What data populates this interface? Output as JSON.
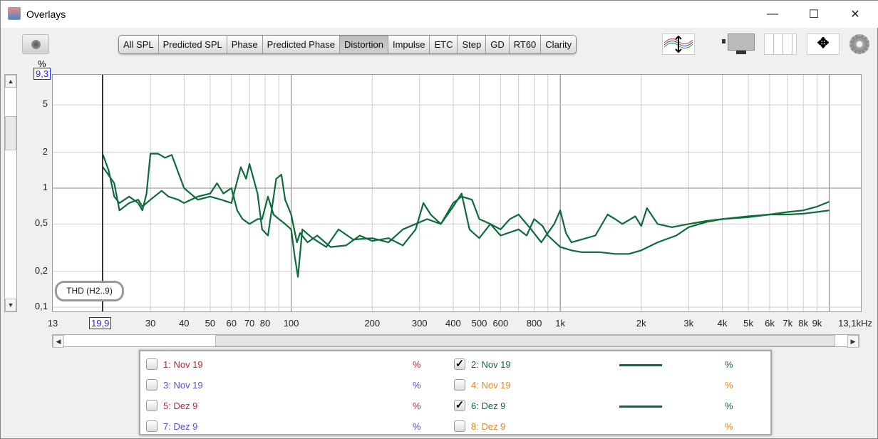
{
  "window": {
    "title": "Overlays",
    "minimize": "—",
    "maximize": "☐",
    "close": "✕"
  },
  "tabs": [
    {
      "label": "All SPL"
    },
    {
      "label": "Predicted SPL"
    },
    {
      "label": "Phase"
    },
    {
      "label": "Predicted Phase"
    },
    {
      "label": "Distortion",
      "active": true
    },
    {
      "label": "Impulse"
    },
    {
      "label": "ETC"
    },
    {
      "label": "Step"
    },
    {
      "label": "GD"
    },
    {
      "label": "RT60"
    },
    {
      "label": "Clarity"
    }
  ],
  "plot": {
    "y_unit": "%",
    "y_top_readout": "9,3",
    "x_cursor_readout": "19,9",
    "overlay_label": "THD (H2..9)"
  },
  "legend": [
    {
      "label": "1: Nov 19",
      "unit": "%",
      "checked": false,
      "color": "#c0282c"
    },
    {
      "label": "2: Nov 19",
      "unit": "%",
      "checked": true,
      "color": "#0e6b3a"
    },
    {
      "label": "3: Nov 19",
      "unit": "%",
      "checked": false,
      "color": "#5050d8"
    },
    {
      "label": "4: Nov 19",
      "unit": "%",
      "checked": false,
      "color": "#e08a20"
    },
    {
      "label": "5: Dez 9",
      "unit": "%",
      "checked": false,
      "color": "#c0282c"
    },
    {
      "label": "6: Dez 9",
      "unit": "%",
      "checked": true,
      "color": "#0e6b3a"
    },
    {
      "label": "7: Dez 9",
      "unit": "%",
      "checked": false,
      "color": "#5050d8"
    },
    {
      "label": "8: Dez 9",
      "unit": "%",
      "checked": false,
      "color": "#e08a20"
    }
  ],
  "chart_data": {
    "type": "line",
    "title": "THD (H2..9)",
    "xlabel": "Hz",
    "ylabel": "%",
    "xscale": "log",
    "yscale": "log",
    "xlim": [
      13,
      13100
    ],
    "ylim": [
      0.09,
      9.3
    ],
    "x_ticks": [
      "13",
      "30",
      "40",
      "50",
      "60",
      "70",
      "80",
      "100",
      "200",
      "300",
      "400",
      "500",
      "600",
      "800",
      "1k",
      "2k",
      "3k",
      "4k",
      "5k",
      "6k",
      "7k",
      "8k",
      "9k",
      "13,1kHz"
    ],
    "y_ticks": [
      "0,1",
      "0,2",
      "0,5",
      "1",
      "2",
      "5"
    ],
    "cursor_x": 19.9,
    "series": [
      {
        "name": "2: Nov 19",
        "color": "#0e6b3a",
        "points": [
          [
            20,
            1.9
          ],
          [
            21,
            1.4
          ],
          [
            22,
            0.85
          ],
          [
            23,
            0.75
          ],
          [
            25,
            0.85
          ],
          [
            27,
            0.75
          ],
          [
            28,
            0.65
          ],
          [
            29,
            0.9
          ],
          [
            30,
            1.95
          ],
          [
            32,
            1.95
          ],
          [
            34,
            1.8
          ],
          [
            36,
            1.9
          ],
          [
            40,
            1.0
          ],
          [
            45,
            0.8
          ],
          [
            50,
            0.85
          ],
          [
            55,
            0.8
          ],
          [
            60,
            0.75
          ],
          [
            62,
            1.0
          ],
          [
            65,
            1.5
          ],
          [
            68,
            1.2
          ],
          [
            70,
            1.6
          ],
          [
            75,
            0.9
          ],
          [
            78,
            0.45
          ],
          [
            82,
            0.4
          ],
          [
            88,
            1.2
          ],
          [
            92,
            1.3
          ],
          [
            95,
            0.8
          ],
          [
            100,
            0.6
          ],
          [
            105,
            0.35
          ],
          [
            108,
            0.42
          ],
          [
            115,
            0.35
          ],
          [
            125,
            0.4
          ],
          [
            140,
            0.32
          ],
          [
            160,
            0.33
          ],
          [
            180,
            0.4
          ],
          [
            200,
            0.36
          ],
          [
            230,
            0.38
          ],
          [
            260,
            0.33
          ],
          [
            290,
            0.45
          ],
          [
            310,
            0.75
          ],
          [
            330,
            0.6
          ],
          [
            360,
            0.5
          ],
          [
            400,
            0.75
          ],
          [
            430,
            0.85
          ],
          [
            470,
            0.8
          ],
          [
            500,
            0.55
          ],
          [
            550,
            0.5
          ],
          [
            600,
            0.45
          ],
          [
            650,
            0.55
          ],
          [
            700,
            0.6
          ],
          [
            780,
            0.45
          ],
          [
            850,
            0.35
          ],
          [
            950,
            0.5
          ],
          [
            1000,
            0.65
          ],
          [
            1050,
            0.42
          ],
          [
            1100,
            0.35
          ],
          [
            1200,
            0.37
          ],
          [
            1350,
            0.4
          ],
          [
            1500,
            0.6
          ],
          [
            1600,
            0.55
          ],
          [
            1700,
            0.5
          ],
          [
            1900,
            0.58
          ],
          [
            2000,
            0.48
          ],
          [
            2100,
            0.68
          ],
          [
            2300,
            0.5
          ],
          [
            2600,
            0.47
          ],
          [
            3000,
            0.5
          ],
          [
            3500,
            0.53
          ],
          [
            4000,
            0.55
          ],
          [
            5000,
            0.57
          ],
          [
            6000,
            0.6
          ],
          [
            7000,
            0.63
          ],
          [
            8000,
            0.65
          ],
          [
            9000,
            0.7
          ],
          [
            10000,
            0.77
          ]
        ]
      },
      {
        "name": "6: Dez 9",
        "color": "#0e6b3a",
        "points": [
          [
            20,
            1.5
          ],
          [
            22,
            1.1
          ],
          [
            23,
            0.65
          ],
          [
            25,
            0.75
          ],
          [
            27,
            0.8
          ],
          [
            28,
            0.7
          ],
          [
            30,
            0.8
          ],
          [
            33,
            0.95
          ],
          [
            35,
            0.85
          ],
          [
            38,
            0.8
          ],
          [
            40,
            0.75
          ],
          [
            45,
            0.85
          ],
          [
            50,
            0.9
          ],
          [
            53,
            1.1
          ],
          [
            56,
            0.9
          ],
          [
            60,
            1.0
          ],
          [
            63,
            0.65
          ],
          [
            66,
            0.55
          ],
          [
            70,
            0.5
          ],
          [
            75,
            0.55
          ],
          [
            78,
            0.55
          ],
          [
            82,
            0.85
          ],
          [
            86,
            0.6
          ],
          [
            90,
            0.55
          ],
          [
            95,
            0.5
          ],
          [
            100,
            0.45
          ],
          [
            103,
            0.27
          ],
          [
            106,
            0.18
          ],
          [
            110,
            0.45
          ],
          [
            120,
            0.38
          ],
          [
            135,
            0.32
          ],
          [
            150,
            0.45
          ],
          [
            170,
            0.37
          ],
          [
            200,
            0.38
          ],
          [
            230,
            0.35
          ],
          [
            260,
            0.45
          ],
          [
            290,
            0.5
          ],
          [
            320,
            0.55
          ],
          [
            360,
            0.5
          ],
          [
            400,
            0.7
          ],
          [
            430,
            0.9
          ],
          [
            460,
            0.45
          ],
          [
            500,
            0.38
          ],
          [
            550,
            0.5
          ],
          [
            600,
            0.4
          ],
          [
            700,
            0.45
          ],
          [
            750,
            0.4
          ],
          [
            800,
            0.55
          ],
          [
            860,
            0.48
          ],
          [
            900,
            0.4
          ],
          [
            1000,
            0.32
          ],
          [
            1100,
            0.3
          ],
          [
            1200,
            0.29
          ],
          [
            1400,
            0.29
          ],
          [
            1600,
            0.28
          ],
          [
            1800,
            0.28
          ],
          [
            2000,
            0.3
          ],
          [
            2300,
            0.35
          ],
          [
            2700,
            0.4
          ],
          [
            3000,
            0.47
          ],
          [
            3500,
            0.52
          ],
          [
            4000,
            0.55
          ],
          [
            5000,
            0.58
          ],
          [
            6000,
            0.6
          ],
          [
            7000,
            0.6
          ],
          [
            8000,
            0.61
          ],
          [
            9000,
            0.63
          ],
          [
            10000,
            0.65
          ]
        ]
      }
    ]
  }
}
